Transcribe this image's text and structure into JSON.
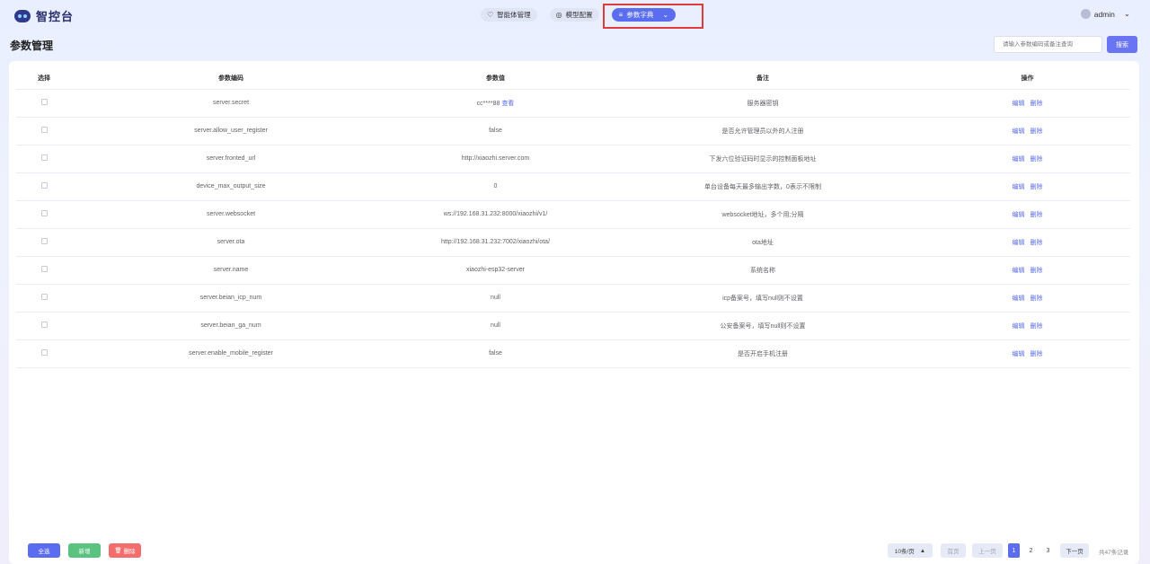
{
  "app": {
    "logo_text": "智控台"
  },
  "nav": {
    "items": [
      {
        "label": "智能体管理",
        "icon": "agent-icon"
      },
      {
        "label": "模型配置",
        "icon": "model-icon"
      },
      {
        "label": "参数字典",
        "icon": "dict-icon",
        "active": true
      }
    ]
  },
  "user": {
    "name": "admin"
  },
  "page": {
    "title": "参数管理"
  },
  "search": {
    "placeholder": "请输入参数编码或备注查询",
    "button_label": "搜索"
  },
  "table": {
    "headers": {
      "select": "选择",
      "code": "参数编码",
      "value": "参数值",
      "note": "备注",
      "ops": "操作"
    },
    "view_label": "查看",
    "edit_label": "编辑",
    "delete_label": "删除",
    "rows": [
      {
        "code": "server.secret",
        "value": "cc****88",
        "note": "服务器密钥",
        "masked": true
      },
      {
        "code": "server.allow_user_register",
        "value": "false",
        "note": "是否允许管理员以外的人注册"
      },
      {
        "code": "server.fronted_url",
        "value": "http://xiaozhi.server.com",
        "note": "下发六位验证码时显示的控制面板地址"
      },
      {
        "code": "device_max_output_size",
        "value": "0",
        "note": "单台设备每天最多输出字数，0表示不限制"
      },
      {
        "code": "server.websocket",
        "value": "ws://192.168.31.232:8000/xiaozhi/v1/",
        "note": "websocket地址，多个用;分隔"
      },
      {
        "code": "server.ota",
        "value": "http://192.168.31.232:7002/xiaozhi/ota/",
        "note": "ota地址"
      },
      {
        "code": "server.name",
        "value": "xiaozhi-esp32-server",
        "note": "系统名称"
      },
      {
        "code": "server.beian_icp_num",
        "value": "null",
        "note": "icp备案号，填写null则不设置"
      },
      {
        "code": "server.beian_ga_num",
        "value": "null",
        "note": "公安备案号，填写null则不设置"
      },
      {
        "code": "server.enable_mobile_register",
        "value": "false",
        "note": "是否开启手机注册"
      }
    ]
  },
  "footer": {
    "select_all": "全选",
    "add": "新增",
    "delete": "删除",
    "page_size": "10条/页",
    "first": "首页",
    "prev": "上一页",
    "pages": [
      "1",
      "2",
      "3"
    ],
    "current_page": "1",
    "next": "下一页",
    "total": "共47条记录"
  },
  "colors": {
    "accent": "#5a6cf0",
    "success": "#5ac37f",
    "danger": "#f56c6c",
    "highlight": "#e03b3b"
  }
}
